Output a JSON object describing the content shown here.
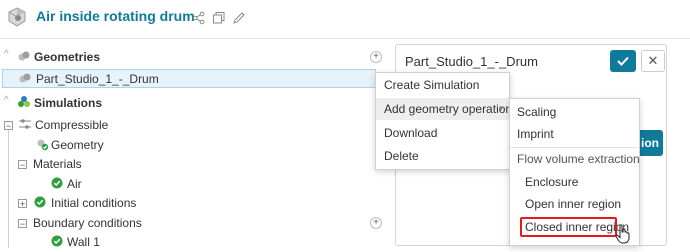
{
  "header": {
    "title": "Air inside rotating drum",
    "icons": [
      "share-icon",
      "copy-icon",
      "edit-icon"
    ]
  },
  "tree": {
    "geometries_label": "Geometries",
    "geometry_item": "Part_Studio_1_-_Drum",
    "simulations_label": "Simulations",
    "compressible_label": "Compressible",
    "geometry_node": "Geometry",
    "materials_label": "Materials",
    "air_label": "Air",
    "initial_conditions_label": "Initial conditions",
    "boundary_conditions_label": "Boundary conditions",
    "wall_label": "Wall 1"
  },
  "panel": {
    "title": "Part_Studio_1_-_Drum",
    "partial_button_text": "ion"
  },
  "context_menu": {
    "items": [
      "Create Simulation",
      "Add geometry operation",
      "Download",
      "Delete"
    ]
  },
  "submenu": {
    "items": [
      "Scaling",
      "Imprint"
    ],
    "section_title": "Flow volume extraction",
    "section_items": [
      "Enclosure",
      "Open inner region",
      "Closed inner region"
    ]
  },
  "colors": {
    "brand": "#0f7a9a",
    "success": "#2e9e3e",
    "highlight": "#e01b1b"
  }
}
